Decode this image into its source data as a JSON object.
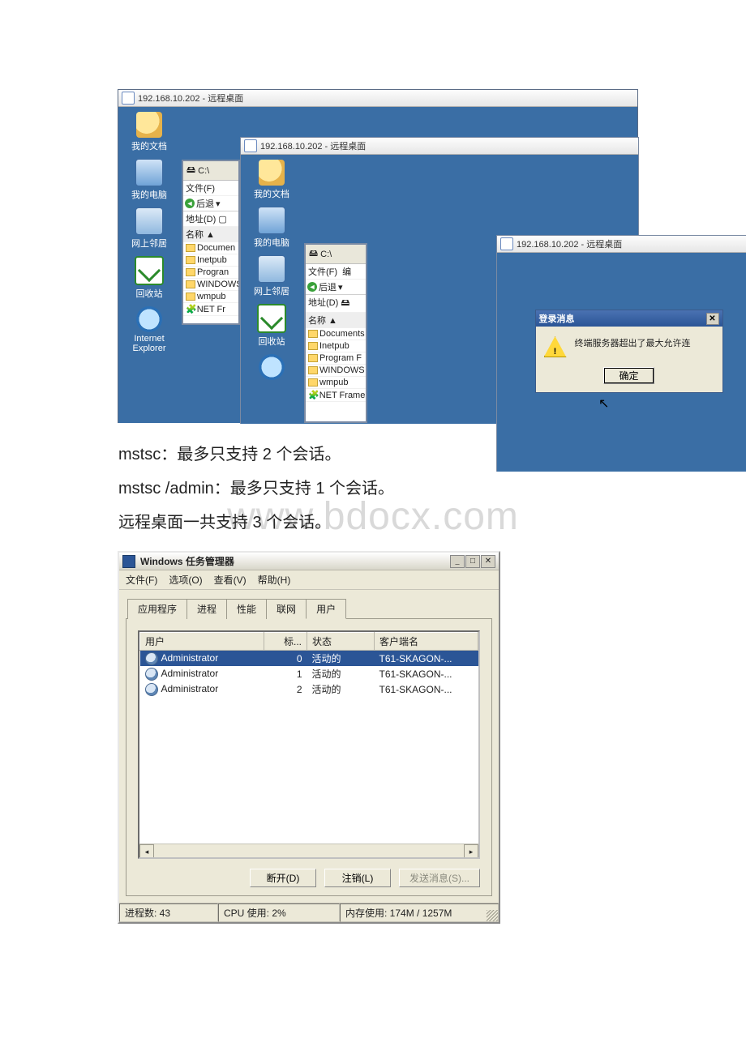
{
  "watermark": "www.bdocx.com",
  "rdp": {
    "title": "192.168.10.202 - 远程桌面",
    "icons": {
      "docs": "我的文档",
      "pc": "我的电脑",
      "net": "网上邻居",
      "rec": "回收站",
      "ie": "Internet\nExplorer"
    },
    "explorer": {
      "drive": "C:\\",
      "file": "文件(F)",
      "edit": "编",
      "back": "后退",
      "addr": "地址(D)",
      "name": "名称",
      "items": [
        "Documents",
        "Inetpub",
        "Program F",
        "WINDOWS",
        "wmpub",
        "NET Frame"
      ],
      "items_short": [
        "Documen",
        "Inetpub",
        "Progran",
        "WINDOWS",
        "wmpub",
        "NET Fr"
      ]
    },
    "msg": {
      "title": "登录消息",
      "text": "终端服务器超出了最大允许连",
      "ok": "确定"
    }
  },
  "paras": {
    "p1": "mstsc：最多只支持 2 个会话。",
    "p2": "mstsc /admin：最多只支持 1 个会话。",
    "p3": "远程桌面一共支持 3 个会话。"
  },
  "tm": {
    "title": "Windows 任务管理器",
    "menus": {
      "file": "文件(F)",
      "options": "选项(O)",
      "view": "查看(V)",
      "help": "帮助(H)"
    },
    "tabs": {
      "apps": "应用程序",
      "proc": "进程",
      "perf": "性能",
      "net": "联网",
      "users": "用户"
    },
    "cols": {
      "user": "用户",
      "id": "标...",
      "state": "状态",
      "client": "客户端名"
    },
    "rows": [
      {
        "user": "Administrator",
        "id": "0",
        "state": "活动的",
        "client": "T61-SKAGON-..."
      },
      {
        "user": "Administrator",
        "id": "1",
        "state": "活动的",
        "client": "T61-SKAGON-..."
      },
      {
        "user": "Administrator",
        "id": "2",
        "state": "活动的",
        "client": "T61-SKAGON-..."
      }
    ],
    "btns": {
      "disconnect": "断开(D)",
      "logoff": "注销(L)",
      "send": "发送消息(S)..."
    },
    "status": {
      "proc": "进程数: 43",
      "cpu": "CPU 使用: 2%",
      "mem": "内存使用: 174M / 1257M"
    }
  }
}
